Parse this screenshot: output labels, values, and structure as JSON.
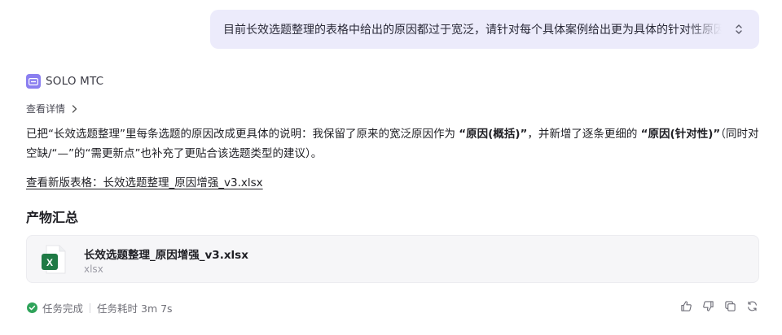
{
  "user_message": {
    "text": "目前长效选题整理的表格中给出的原因都过于宽泛，请针对每个具体案例给出更为具体的针对性原因",
    "expand_icon": "chevron-up-down-icon"
  },
  "bot": {
    "name": "SOLO MTC",
    "avatar_icon": "bot-keyboard-icon",
    "details_label": "查看详情"
  },
  "response": {
    "part1": "已把“长效选题整理”里每条选题的原因改成更具体的说明：我保留了原来的宽泛原因作为 ",
    "bold1": "“原因(概括)”",
    "part2": "，并新增了逐条更细的 ",
    "bold2": "“原因(针对性)”",
    "part3": "（同时对空缺/“—”的“需更新点”也补充了更贴合该选题类型的建议）。",
    "link_label": "查看新版表格：长效选题整理_原因增强_v3.xlsx"
  },
  "artifacts": {
    "title": "产物汇总",
    "file": {
      "name": "长效选题整理_原因增强_v3.xlsx",
      "ext": "xlsx",
      "icon": "excel-file-icon",
      "icon_letter": "X"
    }
  },
  "status": {
    "complete_label": "任务完成",
    "duration_label": "任务耗时 3m 7s"
  },
  "colors": {
    "bubble_bg": "#ecebfb",
    "avatar": "#8b7ff0",
    "excel_green": "#1f7a45",
    "success_green": "#2fa35a"
  }
}
